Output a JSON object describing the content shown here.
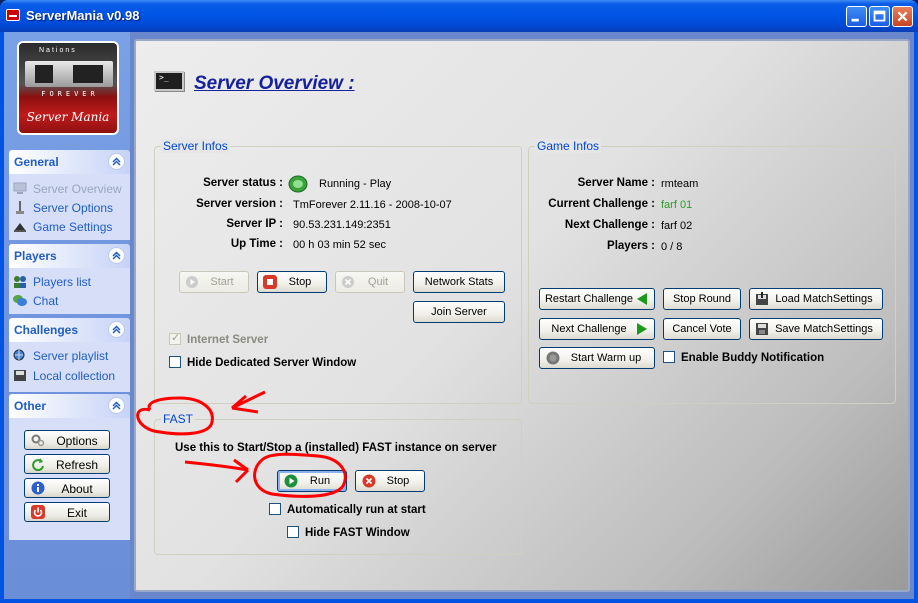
{
  "window": {
    "title": "ServerMania v0.98",
    "controls": [
      "minimize",
      "maximize",
      "close"
    ]
  },
  "logo": {
    "text": "Server Mania",
    "forever": "FOREVER",
    "top": "Nations"
  },
  "sidebar": {
    "sections": [
      {
        "title": "General",
        "items": [
          {
            "label": "Server Overview",
            "icon": "monitor-icon",
            "disabled": true
          },
          {
            "label": "Server Options",
            "icon": "wrench-icon"
          },
          {
            "label": "Game Settings",
            "icon": "game-icon"
          }
        ]
      },
      {
        "title": "Players",
        "items": [
          {
            "label": "Players list",
            "icon": "users-icon"
          },
          {
            "label": "Chat",
            "icon": "chat-icon"
          }
        ]
      },
      {
        "title": "Challenges",
        "items": [
          {
            "label": "Server playlist",
            "icon": "globe-icon"
          },
          {
            "label": "Local collection",
            "icon": "disk-icon"
          }
        ]
      },
      {
        "title": "Other",
        "buttons": [
          {
            "label": "Options",
            "icon": "gears-icon"
          },
          {
            "label": "Refresh",
            "icon": "refresh-icon"
          },
          {
            "label": "About",
            "icon": "info-icon"
          },
          {
            "label": "Exit",
            "icon": "power-icon"
          }
        ]
      }
    ]
  },
  "main": {
    "title": "Server Overview :",
    "server_infos": {
      "legend": "Server Infos",
      "status_label": "Server status :",
      "status_value": "Running - Play",
      "version_label": "Server version :",
      "version_value": "TmForever 2.11.16 - 2008-10-07",
      "ip_label": "Server IP :",
      "ip_value": "90.53.231.149:2351",
      "uptime_label": "Up Time :",
      "uptime_value": "00 h 03 min 52 sec",
      "btn_start": "Start",
      "btn_stop": "Stop",
      "btn_quit": "Quit",
      "btn_network_stats": "Network Stats",
      "btn_join_server": "Join Server",
      "chk_internet": "Internet Server",
      "chk_hide_window": "Hide Dedicated Server Window"
    },
    "game_infos": {
      "legend": "Game Infos",
      "name_label": "Server Name :",
      "name_value": "rmteam",
      "current_label": "Current Challenge :",
      "current_value": "farf 01",
      "next_label": "Next Challenge :",
      "next_value": "farf 02",
      "players_label": "Players :",
      "players_value": "0 / 8",
      "btn_restart": "Restart Challenge",
      "btn_stop_round": "Stop Round",
      "btn_load_match": "Load MatchSettings",
      "btn_next": "Next Challenge",
      "btn_cancel_vote": "Cancel Vote",
      "btn_save_match": "Save MatchSettings",
      "btn_warmup": "Start Warm up",
      "chk_buddy": "Enable Buddy Notification"
    },
    "fast": {
      "legend": "FAST",
      "description": "Use this to Start/Stop a (installed) FAST instance on server",
      "btn_run": "Run",
      "btn_stop": "Stop",
      "chk_auto": "Automatically run at start",
      "chk_hide": "Hide FAST Window"
    }
  },
  "colors": {
    "accent": "#215dc6",
    "title_blue": "#16219c",
    "legend_blue": "#0046d5",
    "annotation_red": "#ff0000",
    "green_value": "#2b9a2b"
  }
}
